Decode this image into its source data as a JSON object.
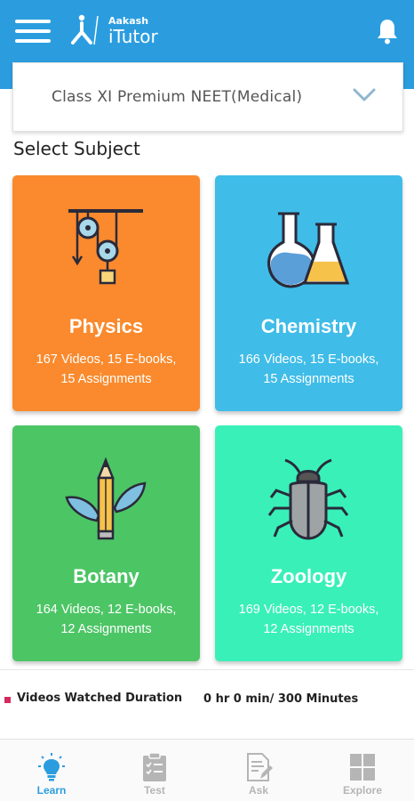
{
  "header": {
    "brand_top": "Aakash",
    "brand_name": "iTutor",
    "icons": [
      "hamburger-menu-icon",
      "aakash-logo-icon",
      "bell-icon"
    ]
  },
  "class_selector": {
    "value": "Class XI Premium NEET(Medical)",
    "icon": "chevron-down-icon"
  },
  "section_title": "Select Subject",
  "subjects": [
    {
      "name": "Physics",
      "meta_line1": "167 Videos, 15 E-books,",
      "meta_line2": "15 Assignments",
      "color": "#fa8a2d",
      "icon": "pulley-icon"
    },
    {
      "name": "Chemistry",
      "meta_line1": "166 Videos, 15 E-books,",
      "meta_line2": "15 Assignments",
      "color": "#3fbce8",
      "icon": "flask-icon"
    },
    {
      "name": "Botany",
      "meta_line1": "164 Videos, 12 E-books,",
      "meta_line2": "12 Assignments",
      "color": "#4cc565",
      "icon": "pencil-leaf-icon"
    },
    {
      "name": "Zoology",
      "meta_line1": "169 Videos, 12 E-books,",
      "meta_line2": "12 Assignments",
      "color": "#38f0b8",
      "icon": "beetle-icon"
    }
  ],
  "watch_stats": {
    "label": "Videos Watched Duration",
    "value": "0 hr 0 min/ 300 Minutes",
    "indicator_color": "#d32a5f"
  },
  "bottom_nav": [
    {
      "label": "Learn",
      "icon": "lightbulb-icon",
      "active": true
    },
    {
      "label": "Test",
      "icon": "clipboard-icon",
      "active": false
    },
    {
      "label": "Ask",
      "icon": "document-edit-icon",
      "active": false
    },
    {
      "label": "Explore",
      "icon": "grid-icon",
      "active": false
    }
  ],
  "colors": {
    "primary": "#2b9ddf",
    "nav_inactive": "#b5b5b5"
  }
}
